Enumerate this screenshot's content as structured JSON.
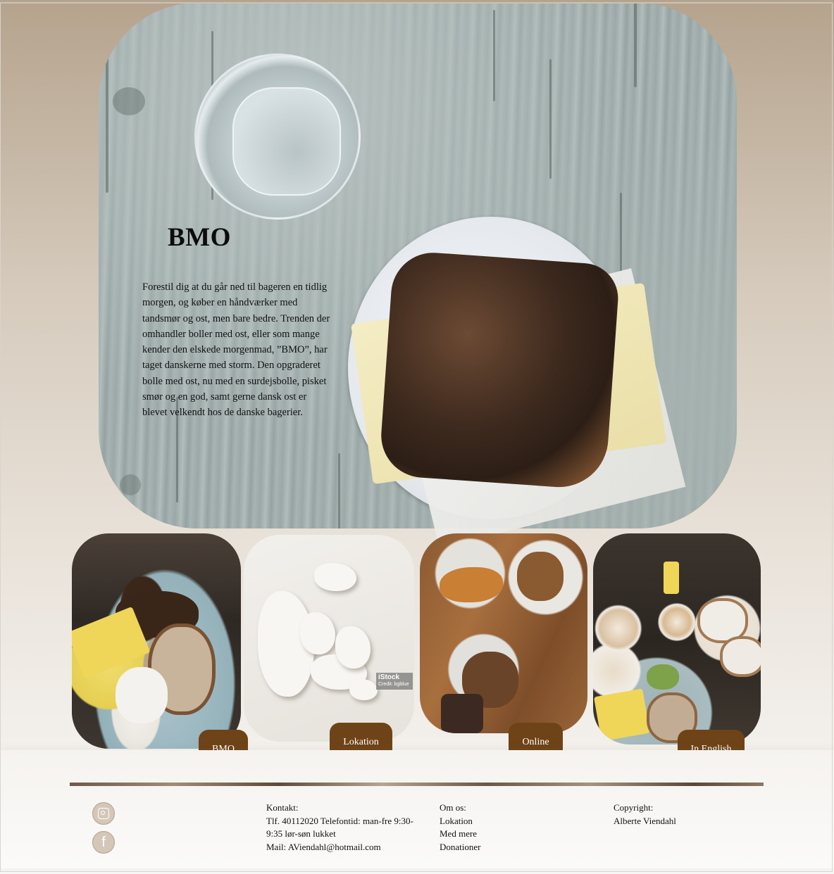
{
  "hero": {
    "title": "BMO",
    "text": "Forestil dig at du går ned til bageren en tidlig morgen, og køber en håndværker med tandsmør og ost, men bare bedre. Trenden der omhandler boller med ost, eller som mange kender den elskede morgenmad, ”BMO”, har taget danskerne med storm. Den opgraderet bolle med ost, nu med en surdejsbolle, pisket smør og en god, samt gerne dansk ost er blevet velkendt hos de danske bagerier."
  },
  "cards": {
    "watermark_brand": "iStock",
    "watermark_credit": "Credit: bgblue"
  },
  "nav": {
    "bmo": "BMO",
    "lokation": "Lokation",
    "online": "Online",
    "english": "In English"
  },
  "footer": {
    "contact_heading": "Kontakt:",
    "contact_phone": "Tlf. 40112020 Telefontid: man-fre 9:30-9:35 lør-søn lukket",
    "contact_mail": "Mail: AViendahl@hotmail.com",
    "about_heading": "Om os:",
    "about_links": [
      "Lokation",
      "Med mere",
      "Donationer"
    ],
    "copyright_heading": "Copyright:",
    "copyright_name": "Alberte Viendahl",
    "icons": [
      "instagram-icon",
      "facebook-icon"
    ]
  },
  "colors": {
    "button": "#6e4317",
    "background_top": "#b5a38d",
    "background_bottom": "#f7f6f4"
  }
}
